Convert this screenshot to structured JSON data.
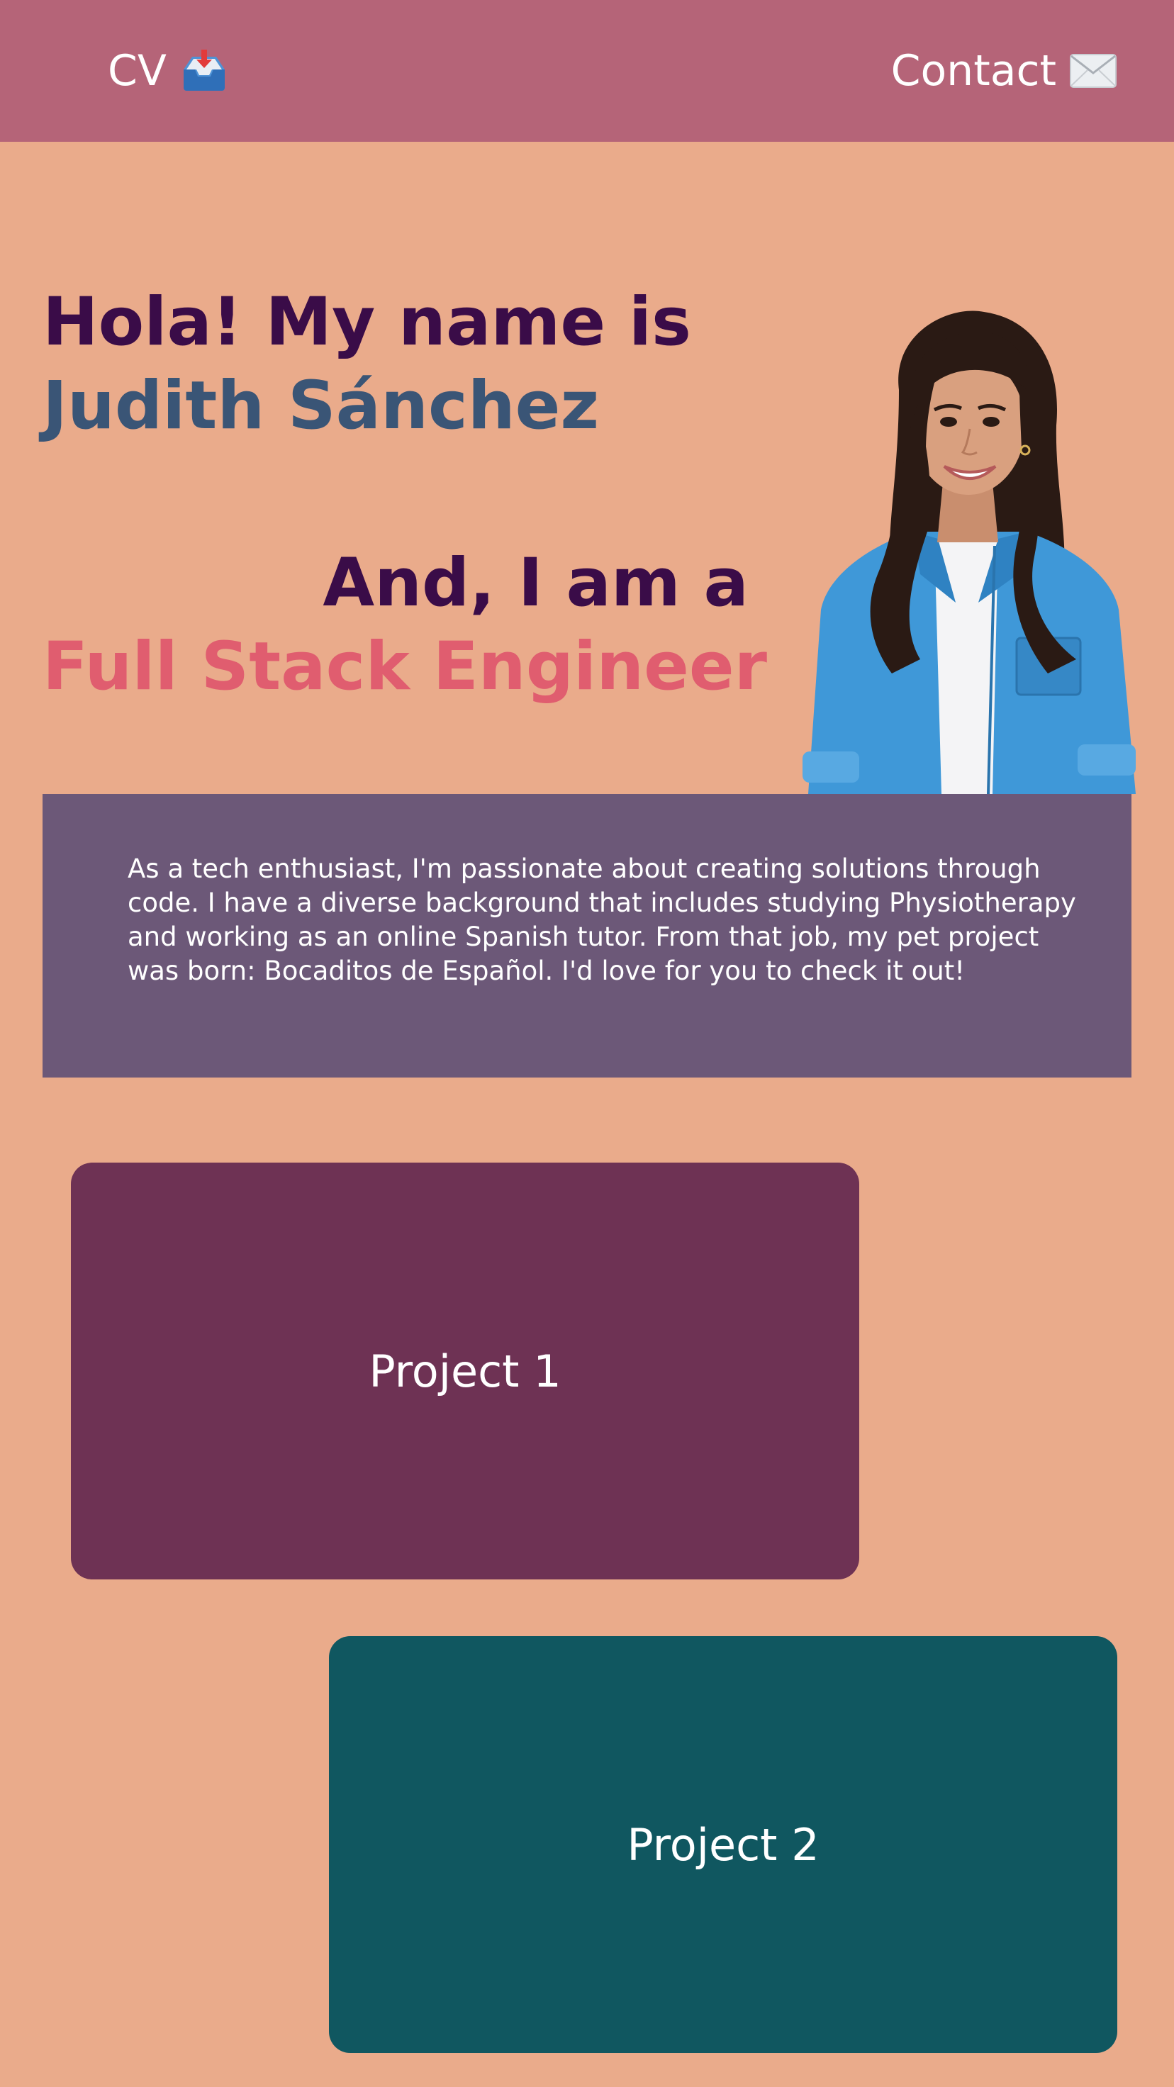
{
  "header": {
    "cv_label": "CV",
    "cv_icon": "inbox-tray-icon",
    "contact_label": "Contact",
    "contact_icon": "envelope-icon"
  },
  "hero": {
    "greeting": "Hola! My name is",
    "name": "Judith Sánchez",
    "intro": "And, I am a",
    "role": "Full Stack Engineer"
  },
  "about": {
    "text": "As a tech enthusiast, I'm passionate about creating solutions through code. I have a diverse background that includes studying Physiotherapy and working as an online Spanish tutor. From that job, my pet project was born: Bocaditos de Español. I'd love for you to check it out!"
  },
  "projects": [
    {
      "label": "Project 1"
    },
    {
      "label": "Project 2"
    }
  ],
  "colors": {
    "background": "#eaab8b",
    "header": "#b56478",
    "about_box": "#6c5878",
    "project_1": "#6e3254",
    "project_2": "#105760",
    "name_color": "#3a5576",
    "role_color": "#e05d6f",
    "heading_color": "#3a0c48"
  }
}
